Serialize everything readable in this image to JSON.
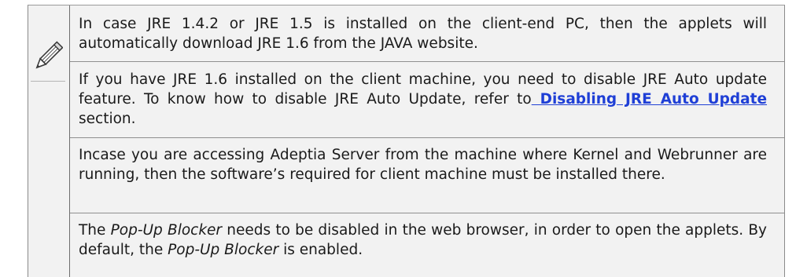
{
  "note": {
    "icon": "pencil-icon",
    "paragraphs": {
      "p1": {
        "text": "In case JRE 1.4.2 or JRE 1.5 is installed on the client-end PC, then the applets will automatically download JRE 1.6 from the JAVA website."
      },
      "p2": {
        "before": "If you have JRE 1.6 installed on the client machine, you need to disable JRE Auto update feature. To know how to disable JRE Auto Update, refer to",
        "link": " Disabling JRE Auto Update",
        "after": " section."
      },
      "p3": {
        "text": "Incase you are accessing Adeptia Server from the machine where Kernel and Webrunner are running, then the software’s required for client machine must be installed there."
      },
      "p4": {
        "t1": "The ",
        "em1": "Pop-Up Blocker",
        "t2": " needs to be disabled in the web browser, in order to open the applets. By default, the ",
        "em2": "Pop-Up Blocker",
        "t3": " is enabled."
      }
    },
    "colors": {
      "link": "#1f3fd6",
      "box_background": "#f2f2f2",
      "border": "#8a8a8a"
    }
  }
}
